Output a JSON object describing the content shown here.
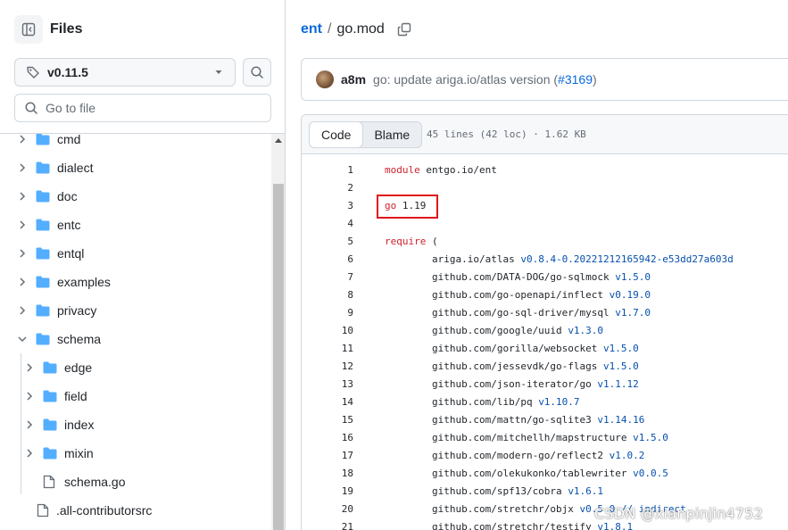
{
  "sidebar": {
    "title": "Files",
    "branch": "v0.11.5",
    "search_placeholder": "Go to file",
    "tree": [
      {
        "name": "cmd",
        "type": "folder",
        "expanded": false,
        "depth": 0
      },
      {
        "name": "dialect",
        "type": "folder",
        "expanded": false,
        "depth": 0
      },
      {
        "name": "doc",
        "type": "folder",
        "expanded": false,
        "depth": 0
      },
      {
        "name": "entc",
        "type": "folder",
        "expanded": false,
        "depth": 0
      },
      {
        "name": "entql",
        "type": "folder",
        "expanded": false,
        "depth": 0
      },
      {
        "name": "examples",
        "type": "folder",
        "expanded": false,
        "depth": 0
      },
      {
        "name": "privacy",
        "type": "folder",
        "expanded": false,
        "depth": 0
      },
      {
        "name": "schema",
        "type": "folder",
        "expanded": true,
        "depth": 0
      },
      {
        "name": "edge",
        "type": "folder",
        "expanded": false,
        "depth": 1
      },
      {
        "name": "field",
        "type": "folder",
        "expanded": false,
        "depth": 1
      },
      {
        "name": "index",
        "type": "folder",
        "expanded": false,
        "depth": 1
      },
      {
        "name": "mixin",
        "type": "folder",
        "expanded": false,
        "depth": 1
      },
      {
        "name": "schema.go",
        "type": "file",
        "depth": 1
      },
      {
        "name": ".all-contributorsrc",
        "type": "file",
        "depth": 0
      }
    ]
  },
  "breadcrumb": {
    "repo": "ent",
    "separator": "/",
    "file": "go.mod"
  },
  "commit": {
    "author": "a8m",
    "message": "go: update ariga.io/atlas version (",
    "pr": "#3169",
    "message_end": ")"
  },
  "file_header": {
    "code_tab": "Code",
    "blame_tab": "Blame",
    "info": "45 lines (42 loc) · 1.62 KB"
  },
  "code_lines": [
    {
      "n": "1",
      "parts": [
        [
          "kw",
          "module"
        ],
        [
          "",
          " entgo.io/ent"
        ]
      ]
    },
    {
      "n": "2",
      "parts": []
    },
    {
      "n": "3",
      "parts": [
        [
          "kw",
          "go"
        ],
        [
          "",
          " 1.19"
        ]
      ]
    },
    {
      "n": "4",
      "parts": []
    },
    {
      "n": "5",
      "parts": [
        [
          "kw",
          "require"
        ],
        [
          "",
          " ("
        ]
      ]
    },
    {
      "n": "6",
      "parts": [
        [
          "",
          "\tariga.io/atlas "
        ],
        [
          "ver",
          "v0.8.4-0.20221212165942-e53dd27a603d"
        ]
      ]
    },
    {
      "n": "7",
      "parts": [
        [
          "",
          "\tgithub.com/DATA-DOG/go-sqlmock "
        ],
        [
          "ver",
          "v1.5.0"
        ]
      ]
    },
    {
      "n": "8",
      "parts": [
        [
          "",
          "\tgithub.com/go-openapi/inflect "
        ],
        [
          "ver",
          "v0.19.0"
        ]
      ]
    },
    {
      "n": "9",
      "parts": [
        [
          "",
          "\tgithub.com/go-sql-driver/mysql "
        ],
        [
          "ver",
          "v1.7.0"
        ]
      ]
    },
    {
      "n": "10",
      "parts": [
        [
          "",
          "\tgithub.com/google/uuid "
        ],
        [
          "ver",
          "v1.3.0"
        ]
      ]
    },
    {
      "n": "11",
      "parts": [
        [
          "",
          "\tgithub.com/gorilla/websocket "
        ],
        [
          "ver",
          "v1.5.0"
        ]
      ]
    },
    {
      "n": "12",
      "parts": [
        [
          "",
          "\tgithub.com/jessevdk/go-flags "
        ],
        [
          "ver",
          "v1.5.0"
        ]
      ]
    },
    {
      "n": "13",
      "parts": [
        [
          "",
          "\tgithub.com/json-iterator/go "
        ],
        [
          "ver",
          "v1.1.12"
        ]
      ]
    },
    {
      "n": "14",
      "parts": [
        [
          "",
          "\tgithub.com/lib/pq "
        ],
        [
          "ver",
          "v1.10.7"
        ]
      ]
    },
    {
      "n": "15",
      "parts": [
        [
          "",
          "\tgithub.com/mattn/go-sqlite3 "
        ],
        [
          "ver",
          "v1.14.16"
        ]
      ]
    },
    {
      "n": "16",
      "parts": [
        [
          "",
          "\tgithub.com/mitchellh/mapstructure "
        ],
        [
          "ver",
          "v1.5.0"
        ]
      ]
    },
    {
      "n": "17",
      "parts": [
        [
          "",
          "\tgithub.com/modern-go/reflect2 "
        ],
        [
          "ver",
          "v1.0.2"
        ]
      ]
    },
    {
      "n": "18",
      "parts": [
        [
          "",
          "\tgithub.com/olekukonko/tablewriter "
        ],
        [
          "ver",
          "v0.0.5"
        ]
      ]
    },
    {
      "n": "19",
      "parts": [
        [
          "",
          "\tgithub.com/spf13/cobra "
        ],
        [
          "ver",
          "v1.6.1"
        ]
      ]
    },
    {
      "n": "20",
      "parts": [
        [
          "",
          "\tgithub.com/stretchr/objx "
        ],
        [
          "ver",
          "v0.5.0 // indirect"
        ]
      ]
    },
    {
      "n": "21",
      "parts": [
        [
          "",
          "\tgithub.com/stretchr/testify "
        ],
        [
          "ver",
          "v1.8.1"
        ]
      ]
    }
  ],
  "watermark": "CSDN @xianpinjin4752",
  "colors": {
    "link": "#0969da",
    "keyword": "#cf222e",
    "version": "#0550ae",
    "folder": "#54aeff",
    "annotation_box": "#e0161b"
  }
}
